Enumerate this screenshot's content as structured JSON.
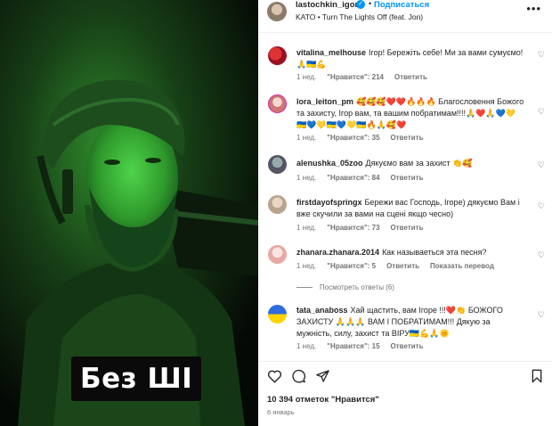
{
  "header": {
    "username": "lastochkin_igor",
    "verified_icon": "verified-badge-icon",
    "separator": "•",
    "follow_label": "Подписаться",
    "song": "KATO • Turn The Lights Off (feat. Jon)",
    "more_icon": "more-icon"
  },
  "media": {
    "caption": "Без ШІ"
  },
  "comments": [
    {
      "user": "vitalina_melhouse",
      "text": "Ігор! Бережіть себе! Ми за вами сумуємо! 🙏🇺🇦💪",
      "time": "1 нед.",
      "likes": "\"Нравится\": 214",
      "reply": "Ответить"
    },
    {
      "user": "lora_leiton_pm",
      "text": "🥰🥰🥰❤️❤️🔥🔥🔥 Благословення Божого та захисту, Ігор вам, та вашим побратимам!!!!🙏❤️🙏💙💛🇺🇦💙💛🇺🇦💙💛🇺🇦🔥🙏🥰❤️",
      "time": "1 нед.",
      "likes": "\"Нравится\": 35",
      "reply": "Ответить"
    },
    {
      "user": "alenushka_05zoo",
      "text": "Дякуємо вам за захист 👏🥰",
      "time": "1 нед.",
      "likes": "\"Нравится\": 84",
      "reply": "Ответить"
    },
    {
      "user": "firstdayofspringx",
      "text": "Бережи вас Господь, Ігоре) дякуємо Вам і вже скучили за вами на сцені якщо чесно)",
      "time": "1 нед.",
      "likes": "\"Нравится\": 73",
      "reply": "Ответить"
    },
    {
      "user": "zhanara.zhanara.2014",
      "text": "Как называеться эта песня?",
      "time": "1 нед.",
      "likes": "\"Нравится\": 5",
      "reply": "Ответить",
      "translate": "Показать перевод",
      "view_replies": "Посмотреть ответы (6)"
    },
    {
      "user": "tata_anaboss",
      "text": "Хай щастить, вам Ігоре !!!❤️👏 БОЖОГО ЗАХИСТУ 🙏🙏🙏 ВАМ І ПОБРАТИМАМ!!! Дякую за мужність, силу, захист та ВІРУ🇺🇦💪🙏🌞",
      "time": "1 нед.",
      "likes": "\"Нравится\": 15",
      "reply": "Ответить"
    }
  ],
  "actions": {
    "like_icon": "heart-icon",
    "comment_icon": "comment-icon",
    "share_icon": "share-icon",
    "save_icon": "bookmark-icon"
  },
  "likes_count": "10 394 отметок \"Нравится\"",
  "post_date": "6 январь"
}
